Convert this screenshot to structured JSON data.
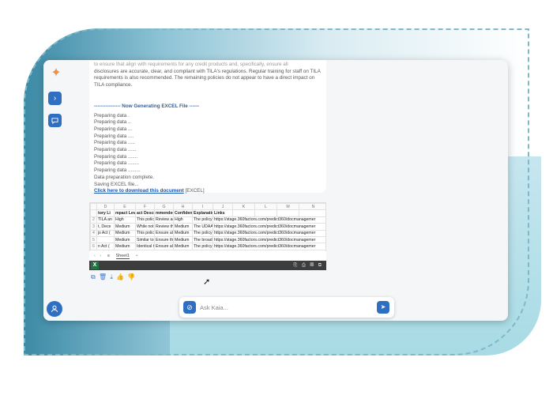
{
  "chat": {
    "paragraph_line1": "to ensure that align with requirements for any credit products and, specifically, ensure all",
    "paragraph_line2": "disclosures are accurate, clear, and compliant with TILA's regulations. Regular training for staff on TILA",
    "paragraph_line3": "requirements is also recommended. The remaining policies do not appear to have a direct impact on",
    "paragraph_line4": "TILA compliance.",
    "generating_heading": "---------------- Now Generating EXCEL File ------",
    "progress_lines": [
      "Preparing data .",
      "Preparing data ..",
      "Preparing data ...",
      "Preparing data ....",
      "Preparing data .....",
      "Preparing data ......",
      "Preparing data .......",
      "Preparing data ........",
      "Preparing data .........",
      "Data preparation complete.",
      "Saving EXCEL file..."
    ],
    "download_link": "Click here to download this document",
    "download_suffix": "[EXCEL]"
  },
  "sheet": {
    "column_letters": [
      "",
      "D",
      "E",
      "F",
      "G",
      "H",
      "I",
      "J",
      "K",
      "L",
      "M",
      "N"
    ],
    "headers": [
      "",
      "tory Li",
      "mpact Lev",
      "act Descrip",
      "mmended",
      "Confidence",
      "Explanation",
      "Links",
      "",
      "",
      "",
      ""
    ],
    "rows": [
      [
        "2",
        "TILA an",
        "High",
        "This policy",
        "Review an",
        "High",
        "The policy",
        "https://stage.360factors.com/predict360/docmanagemer",
        "",
        "",
        "",
        ""
      ],
      [
        "3",
        "t, Dece",
        "Medium",
        "While not",
        "Review th",
        "Medium",
        "The UDAA",
        "https://stage.360factors.com/predict360/docmanagemer",
        "",
        "",
        "",
        ""
      ],
      [
        "4",
        "js Act (",
        "Medium",
        "This policy",
        "Ensure al",
        "Medium",
        "The policy",
        "https://stage.360factors.com/predict360/docmanagemer",
        "",
        "",
        "",
        ""
      ],
      [
        "5",
        "",
        "Medium",
        "Similar to",
        "Ensure th",
        "Medium",
        "The broad",
        "https://stage.360factors.com/predict360/docmanagemer",
        "",
        "",
        "",
        ""
      ],
      [
        "6",
        "n Act (",
        "Medium",
        "Identical t",
        "Ensure all",
        "Medium",
        "The policy",
        "https://stage.360factors.com/predict360/docmanagemer",
        "",
        "",
        "",
        ""
      ]
    ],
    "tab_name": "Sheet1"
  },
  "input": {
    "placeholder": "Ask Kaia..."
  },
  "colors": {
    "accent": "#2f6fc3",
    "excel_green": "#217346"
  },
  "icons": {
    "logo": "sparkle-icon",
    "expand": "chevron-right-icon",
    "chat": "chat-bubble-icon",
    "user": "user-icon",
    "attach": "paperclip-icon",
    "send": "send-icon"
  }
}
